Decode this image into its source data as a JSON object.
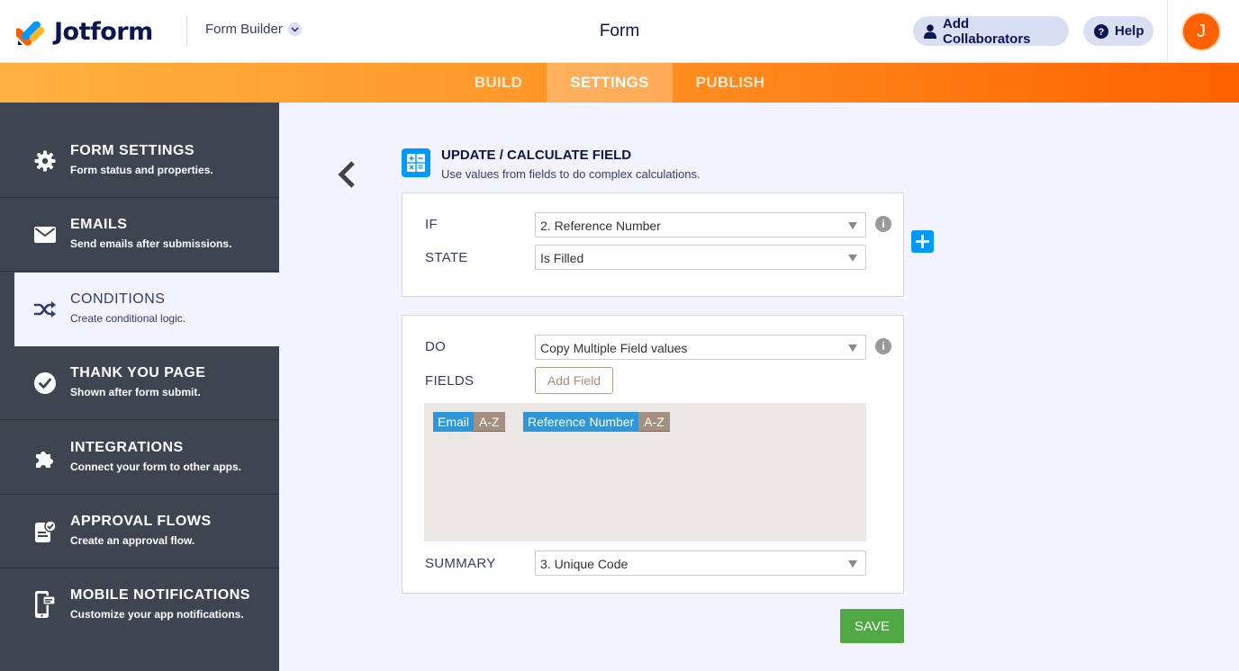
{
  "app": {
    "logo_text": "Jotform",
    "builder_label": "Form Builder",
    "form_title": "Form"
  },
  "header": {
    "collaborators_label": "Add Collaborators",
    "help_label": "Help",
    "avatar_initial": "J"
  },
  "tabs": [
    {
      "label": "BUILD",
      "active": false
    },
    {
      "label": "SETTINGS",
      "active": true
    },
    {
      "label": "PUBLISH",
      "active": false
    }
  ],
  "sidebar": {
    "items": [
      {
        "title": "FORM SETTINGS",
        "subtitle": "Form status and properties.",
        "icon": "gear-icon"
      },
      {
        "title": "EMAILS",
        "subtitle": "Send emails after submissions.",
        "icon": "envelope-icon"
      },
      {
        "title": "CONDITIONS",
        "subtitle": "Create conditional logic.",
        "icon": "shuffle-icon",
        "active": true
      },
      {
        "title": "THANK YOU PAGE",
        "subtitle": "Shown after form submit.",
        "icon": "check-circle-icon"
      },
      {
        "title": "INTEGRATIONS",
        "subtitle": "Connect your form to other apps.",
        "icon": "puzzle-icon"
      },
      {
        "title": "APPROVAL FLOWS",
        "subtitle": "Create an approval flow.",
        "icon": "approval-icon"
      },
      {
        "title": "MOBILE NOTIFICATIONS",
        "subtitle": "Customize your app notifications.",
        "icon": "mobile-icon"
      }
    ]
  },
  "panel": {
    "title": "UPDATE / CALCULATE FIELD",
    "subtitle": "Use values from fields to do complex calculations.",
    "icon": "calculator-icon"
  },
  "condition": {
    "if_label": "IF",
    "if_value": "2. Reference Number",
    "state_label": "STATE",
    "state_value": "Is Filled"
  },
  "action": {
    "do_label": "DO",
    "do_value": "Copy Multiple Field values",
    "fields_label": "FIELDS",
    "add_field_label": "Add Field",
    "fields": [
      {
        "name": "Email",
        "sort": "A-Z"
      },
      {
        "name": "Reference Number",
        "sort": "A-Z"
      }
    ],
    "summary_label": "SUMMARY",
    "summary_value": "3. Unique Code"
  },
  "info_glyph": "i",
  "save_label": "SAVE",
  "colors": {
    "accent_orange": "#ff6100",
    "sidebar_bg": "#3e4550",
    "primary_blue": "#0099ff",
    "save_green": "#4fa844"
  }
}
